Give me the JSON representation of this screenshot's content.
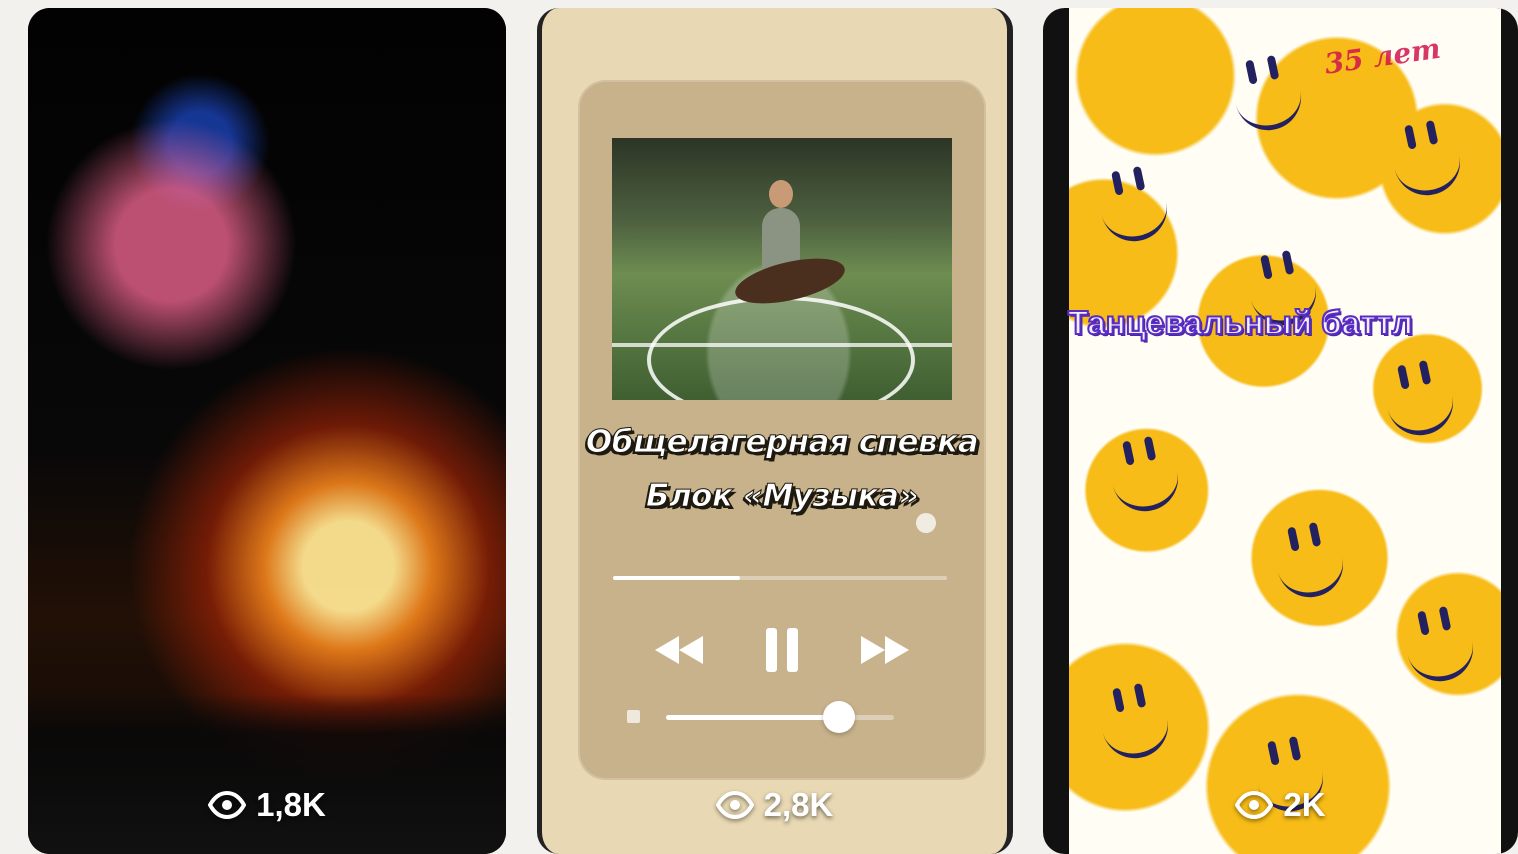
{
  "stories": [
    {
      "views": "1,8K",
      "image_description": "campfire night scene"
    },
    {
      "title_line_1": "Общелагерная  спевка",
      "title_line_2": "Блок «Музыка»",
      "views": "2,8K",
      "player": {
        "progress": 0.38,
        "volume": 0.76,
        "icons": [
          "rewind-icon",
          "pause-icon",
          "forward-icon"
        ]
      }
    },
    {
      "title": "Танцевальный баттл",
      "views": "2K",
      "logo_text": "35 лет"
    }
  ],
  "colors": {
    "page_background": "#f3f1ee",
    "story_2_background": "#e8d8b3",
    "player_card": "#c8b28b",
    "smiley_yellow": "#f7bc17",
    "dance_title_stroke": "#5b2cc2"
  }
}
